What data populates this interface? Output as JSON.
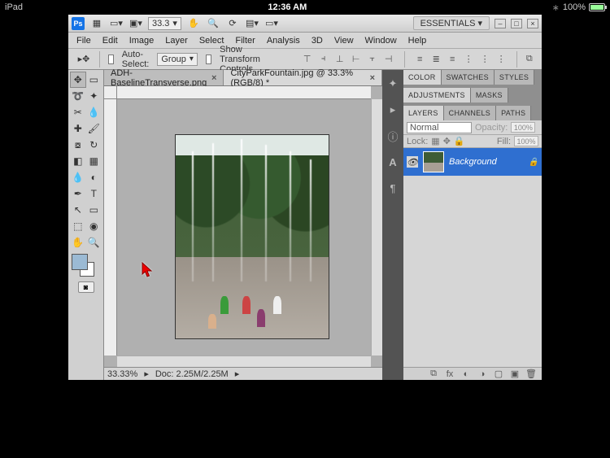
{
  "statusbar_ios": {
    "device": "iPad",
    "time": "12:36 AM",
    "battery_pct": "100%"
  },
  "titlebar": {
    "zoom_value": "33.3",
    "workspace_label": "ESSENTIALS ▾"
  },
  "menu": {
    "file": "File",
    "edit": "Edit",
    "image": "Image",
    "layer": "Layer",
    "select": "Select",
    "filter": "Filter",
    "analysis": "Analysis",
    "threeD": "3D",
    "view": "View",
    "window": "Window",
    "help": "Help"
  },
  "options": {
    "auto_select": "Auto-Select:",
    "auto_select_value": "Group",
    "show_transform": "Show Transform Controls"
  },
  "tabs": {
    "t1": "ADH-BaselineTransverse.png",
    "t2": "CityParkFountain.jpg @ 33.3% (RGB/8) *"
  },
  "status": {
    "zoom": "33.33%",
    "doc": "Doc: 2.25M/2.25M"
  },
  "panel_tabs": {
    "color": "COLOR",
    "swatches": "SWATCHES",
    "styles": "STYLES",
    "adjustments": "ADJUSTMENTS",
    "masks": "MASKS",
    "layers": "LAYERS",
    "channels": "CHANNELS",
    "paths": "PATHS"
  },
  "layers": {
    "blend_mode": "Normal",
    "opacity_label": "Opacity:",
    "opacity_value": "100%",
    "lock_label": "Lock:",
    "fill_label": "Fill:",
    "fill_value": "100%",
    "bg_layer": "Background"
  }
}
